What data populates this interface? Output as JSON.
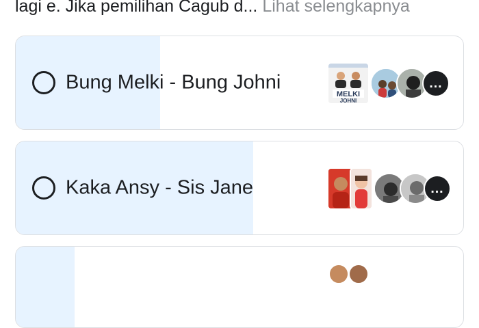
{
  "post": {
    "text_visible": "lagi e. Jika pemilihan Cagub d...",
    "see_more": "Lihat selengkapnya"
  },
  "poll": {
    "options": [
      {
        "label": "Bung Melki - Bung Johni",
        "vote_share": 0.32,
        "poster_text": "MELKI",
        "poster_text2": "JOHNI"
      },
      {
        "label": "Kaka Ansy - Sis Jane",
        "vote_share": 0.53
      },
      {
        "label": "",
        "vote_share": 0.13
      }
    ]
  },
  "colors": {
    "fill": "#e7f3ff",
    "border": "#dcdfe3",
    "see_more": "#8a8d91"
  },
  "icons": {
    "radio": "radio-circle-icon",
    "more": "more-avatars-icon"
  },
  "more_glyph": "…"
}
